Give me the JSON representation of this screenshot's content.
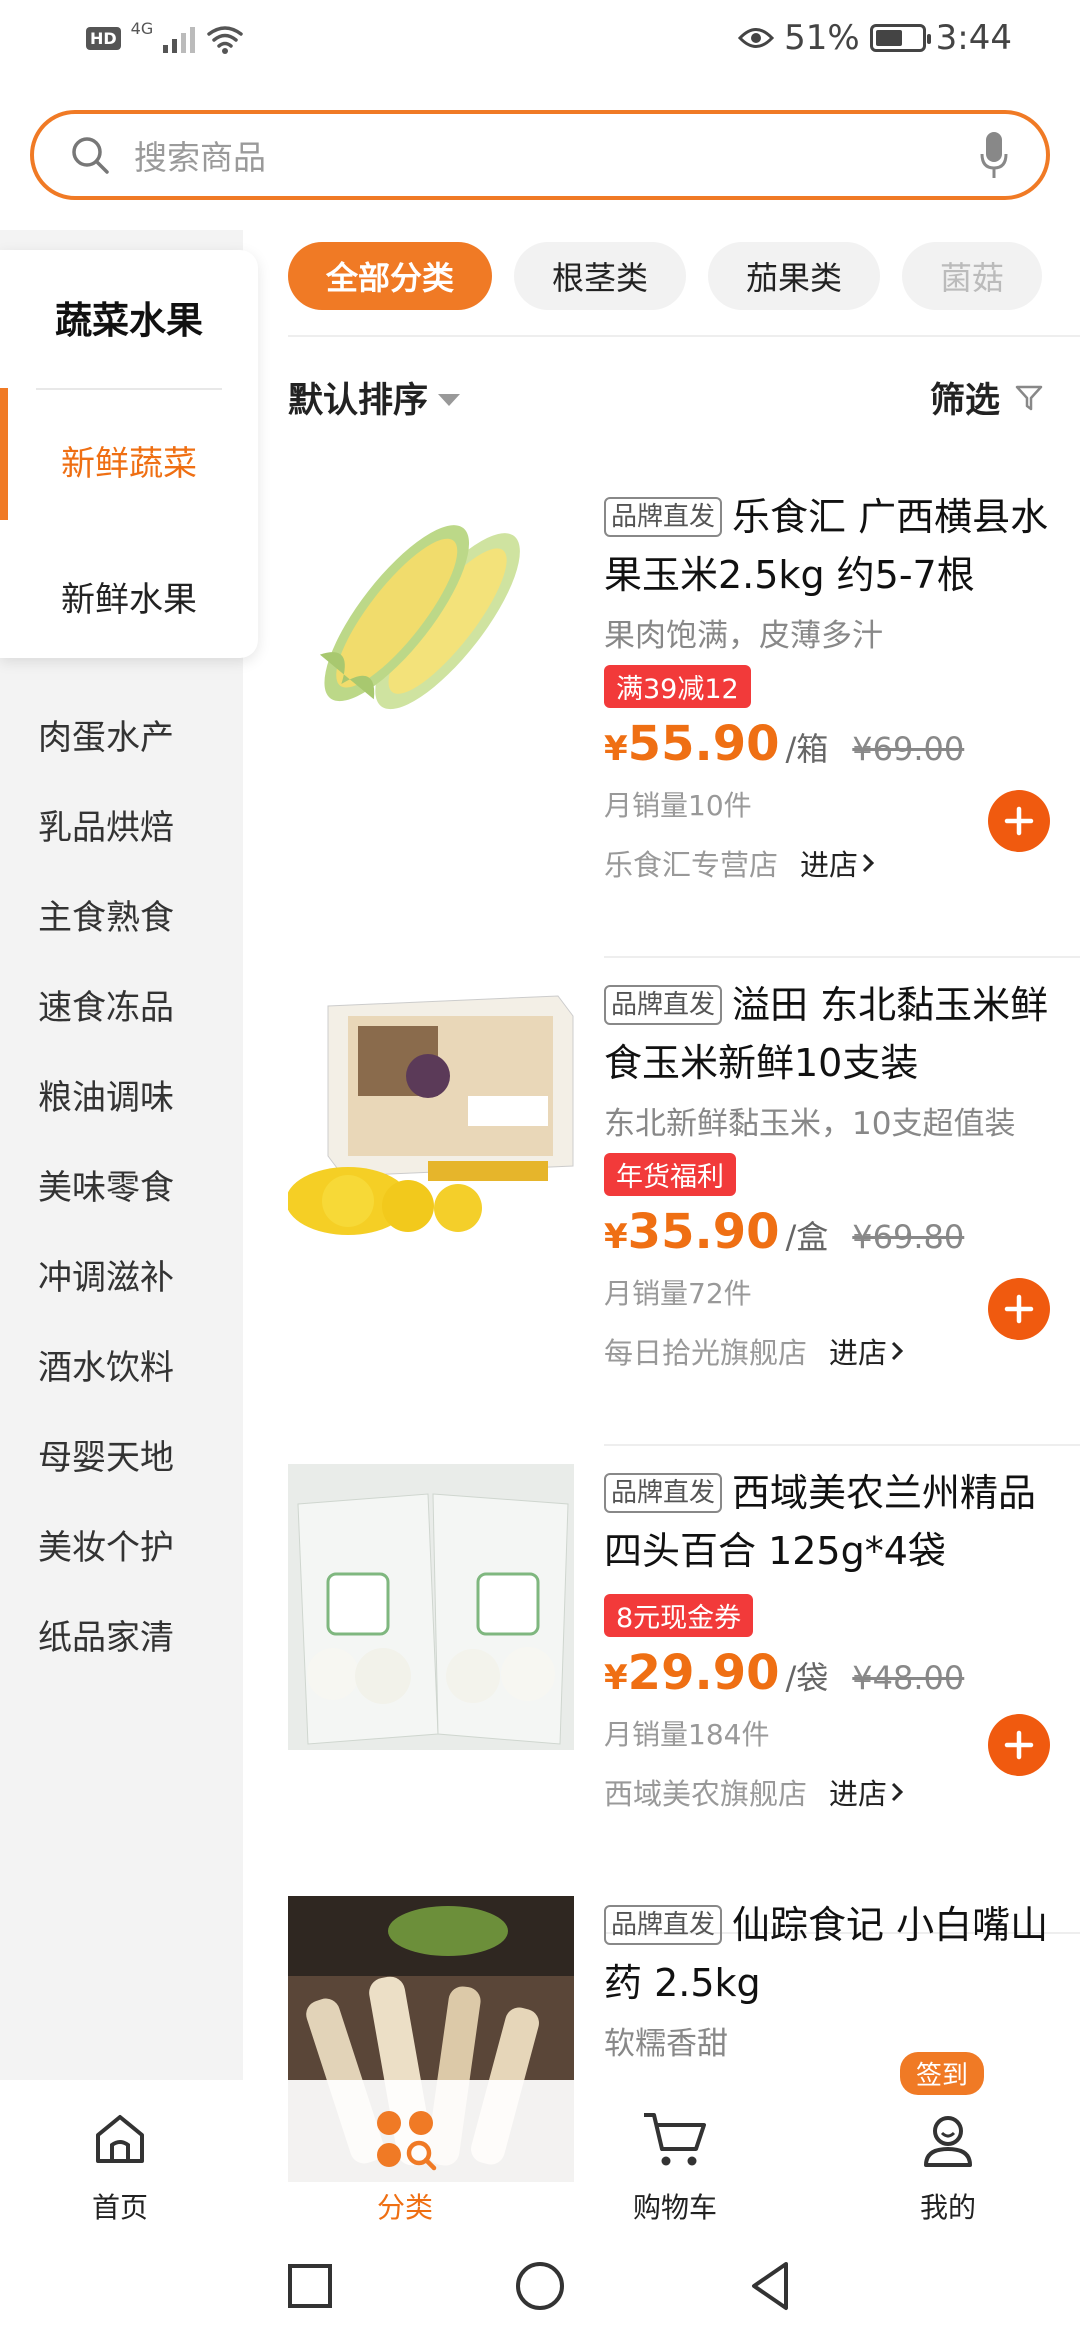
{
  "status_bar": {
    "hd": "HD",
    "network": "4G",
    "battery_pct": "51%",
    "time": "3:44"
  },
  "search": {
    "placeholder": "搜索商品"
  },
  "sidebar": {
    "category_title": "蔬菜水果",
    "sub_items": [
      {
        "label": "新鲜蔬菜",
        "active": true
      },
      {
        "label": "新鲜水果",
        "active": false
      }
    ],
    "items": [
      "肉蛋水产",
      "乳品烘焙",
      "主食熟食",
      "速食冻品",
      "粮油调味",
      "美味零食",
      "冲调滋补",
      "酒水饮料",
      "母婴天地",
      "美妆个护",
      "纸品家清"
    ]
  },
  "tabs": [
    "全部分类",
    "根茎类",
    "茄果类",
    "菌菇"
  ],
  "sort": {
    "label": "默认排序",
    "filter_label": "筛选"
  },
  "products": [
    {
      "brand_tag": "品牌直发",
      "title": "乐食汇 广西横县水果玉米2.5kg 约5-7根",
      "desc": "果肉饱满，皮薄多汁",
      "promo": "满39减12",
      "currency": "¥",
      "price": "55.90",
      "unit": "/箱",
      "orig_price": "¥69.00",
      "sales": "月销量10件",
      "shop": "乐食汇专营店",
      "enter": "进店"
    },
    {
      "brand_tag": "品牌直发",
      "title": "溢田 东北黏玉米鲜食玉米新鲜10支装",
      "desc": "东北新鲜黏玉米，10支超值装",
      "promo": "年货福利",
      "currency": "¥",
      "price": "35.90",
      "unit": "/盒",
      "orig_price": "¥69.80",
      "sales": "月销量72件",
      "shop": "每日拾光旗舰店",
      "enter": "进店"
    },
    {
      "brand_tag": "品牌直发",
      "title": "西域美农兰州精品四头百合 125g*4袋",
      "desc": "",
      "promo": "8元现金券",
      "currency": "¥",
      "price": "29.90",
      "unit": "/袋",
      "orig_price": "¥48.00",
      "sales": "月销量184件",
      "shop": "西域美农旗舰店",
      "enter": "进店"
    },
    {
      "brand_tag": "品牌直发",
      "title": "仙踪食记  小白嘴山药 2.5kg",
      "desc": "软糯香甜"
    }
  ],
  "bottom_nav": {
    "items": [
      "首页",
      "分类",
      "购物车",
      "我的"
    ],
    "active": "分类",
    "badge": "签到"
  },
  "colors": {
    "accent": "#F07A25",
    "price": "#EF6F13",
    "promo_tag": "#F23A3A"
  }
}
